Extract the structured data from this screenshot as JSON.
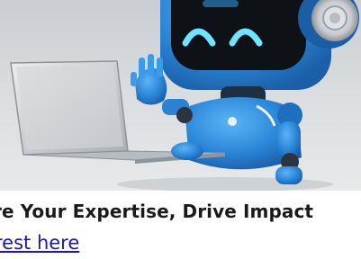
{
  "hero": {
    "image_name": "robot-with-laptop-illustration",
    "colors": {
      "robot_blue": "#2f8fe0",
      "visor": "#111418",
      "eyes": "#6fe3ff",
      "laptop": "#c2c6ca",
      "background": "#d6d9dc"
    }
  },
  "headline": "re Your Expertise, Drive Impact",
  "link": {
    "label": "rest here"
  }
}
